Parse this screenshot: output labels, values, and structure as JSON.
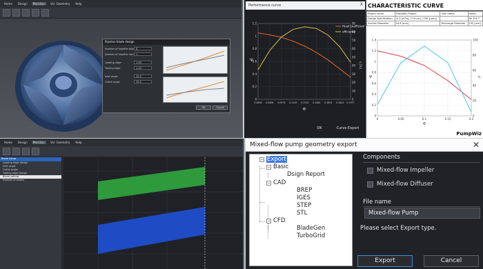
{
  "impeller_app": {
    "menu": [
      "Home",
      "Design",
      "Meridian",
      "Vol. Geometry",
      "Help"
    ],
    "dialog": {
      "title": "Pipeline blade design",
      "rows": [
        {
          "label": "Number of impeller blades",
          "value": "8"
        },
        {
          "label": "Number of impeller vanes",
          "value": "1"
        },
        {
          "label": "Leading edge",
          "value": "1.00"
        },
        {
          "label": "Trailing edge",
          "value": "1.20"
        },
        {
          "label": "Inlet angle",
          "value": "25.0"
        },
        {
          "label": "Outlet angle",
          "value": "20.5"
        }
      ],
      "ok_label": "OK",
      "cancel_label": "Cancel"
    }
  },
  "perf_window": {
    "title": "Performance curve",
    "close_label": "X",
    "legend": [
      "Head coefficient",
      "efficiency"
    ],
    "y_left_label": "Ψ",
    "y_right_label": "η [%]",
    "x_label": "Φ",
    "x_ticks": [
      "0.0634",
      "0.0804",
      "0.0974",
      "0.1144",
      "0.1314",
      "0.1484",
      "0.1654",
      "0.1824",
      "0.1977"
    ],
    "y_left_ticks": [
      "0",
      "0.2",
      "0.4",
      "0.6",
      "0.8",
      "1",
      "1.2"
    ],
    "y_right_ticks": [
      "0",
      "10",
      "20",
      "30",
      "40",
      "50",
      "60",
      "70",
      "80",
      "90"
    ],
    "ok_label": "OK",
    "export_label": "Curve Export"
  },
  "char_report": {
    "title": "CHARACTERISTIC CURVE",
    "table": [
      [
        "Project name",
        "PumpWiz_Project",
        "User name",
        "admin"
      ],
      [
        "Design Specification",
        "(0.2 [m³/s], 27.6 [m], 1780 [rpm])",
        "",
        "Ns 254.7"
      ],
      [
        "Suction Diameter",
        "54.8 [mm]",
        "Discharge Diameter",
        "152 [mm]"
      ]
    ],
    "logo": "PumpWiz"
  },
  "blade_app": {
    "tree_header": "Blade Setup",
    "tree_items": [
      "Leading edge design",
      "Inlet angle",
      "Outlet angle",
      "Trailing edge design",
      "Blade setting",
      "Number of blades"
    ]
  },
  "export_dialog": {
    "title": "Mixed-flow pump geometry export",
    "close_label": "✕",
    "tree": {
      "root": "Export",
      "groups": [
        {
          "name": "Basic",
          "items": [
            "Dsign Report"
          ]
        },
        {
          "name": "CAD",
          "items": [
            "BREP",
            "IGES",
            "STEP",
            "STL"
          ]
        },
        {
          "name": "CFD",
          "items": [
            "BladeGen",
            "TurboGrid"
          ]
        }
      ]
    },
    "components_heading": "Components",
    "components": [
      "Mixed-flow Impeller",
      "Mixed-flow Diffuser"
    ],
    "file_name_heading": "File name",
    "file_name_value": "Mixed-flow Pump",
    "message": "Please select Export type.",
    "export_label": "Export",
    "cancel_label": "Cancel"
  },
  "chart_data": [
    {
      "type": "line",
      "title": "Performance curve",
      "xlabel": "Φ",
      "ylabel": "Ψ",
      "y2label": "η [%]",
      "x": [
        0.0634,
        0.0804,
        0.0974,
        0.1144,
        0.1314,
        0.1484,
        0.1654,
        0.1824,
        0.1977
      ],
      "ylim": [
        0,
        1.2
      ],
      "y2lim": [
        0,
        90
      ],
      "series": [
        {
          "name": "Head coefficient",
          "axis": "left",
          "color": "#e8692d",
          "values": [
            1.05,
            1.02,
            0.98,
            0.92,
            0.84,
            0.74,
            0.62,
            0.48,
            0.35
          ]
        },
        {
          "name": "efficiency",
          "axis": "right",
          "color": "#d8c24a",
          "values": [
            35,
            58,
            74,
            83,
            86,
            84,
            76,
            62,
            44
          ]
        }
      ],
      "legend": "top-right"
    },
    {
      "type": "line",
      "title": "CHARACTERISTIC CURVE",
      "xlabel": "Φ",
      "ylabel": "Ψ",
      "y2label": "η",
      "x": [
        0,
        0.05,
        0.1,
        0.15,
        0.2
      ],
      "xlim": [
        0,
        0.2
      ],
      "ylim": [
        0,
        1.4
      ],
      "y2lim": [
        0,
        100
      ],
      "series": [
        {
          "axis": "left",
          "color": "#e0505a",
          "values": [
            1.2,
            1.1,
            0.93,
            0.65,
            0.3
          ]
        },
        {
          "axis": "right",
          "color": "#5bc8e8",
          "values": [
            15,
            70,
            92,
            70,
            5
          ]
        }
      ]
    }
  ]
}
